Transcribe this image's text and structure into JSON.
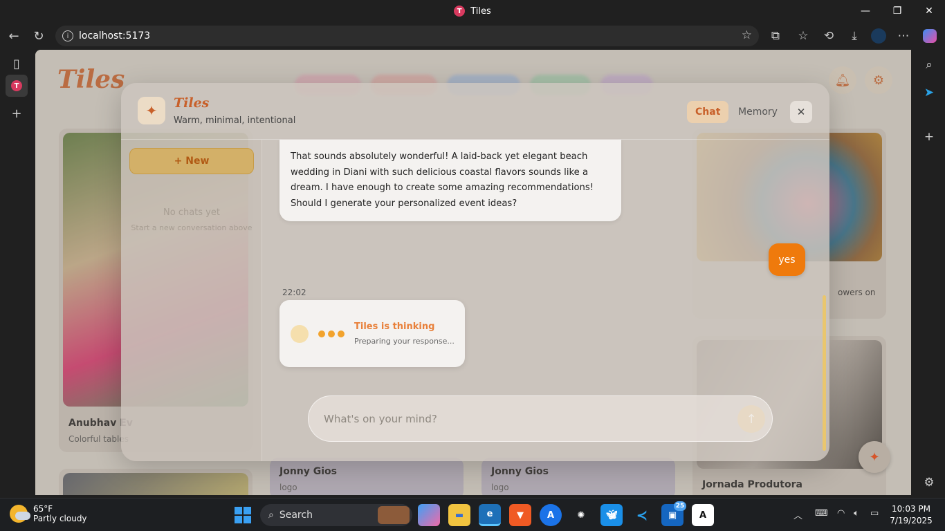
{
  "window": {
    "title": "Tiles",
    "favicon_letter": "T"
  },
  "browser": {
    "address": "localhost:5173"
  },
  "page": {
    "logo": "Tiles",
    "cards": [
      {
        "title": "Anubhav Ev",
        "subtitle": "Colorful tables"
      },
      {
        "title": "Jonny Gios",
        "subtitle": "logo"
      },
      {
        "title": "Jonny Gios",
        "subtitle": "logo"
      },
      {
        "title": "Jornada Produtora",
        "subtitle": ""
      },
      {
        "title": "",
        "subtitle": "owers on"
      }
    ]
  },
  "modal": {
    "title": "Tiles",
    "subtitle": "Warm, minimal, intentional",
    "tabs": [
      {
        "label": "Chat",
        "active": true
      },
      {
        "label": "Memory",
        "active": false
      }
    ],
    "close": "✕",
    "sidebar": {
      "new_label": "+ New",
      "empty_title": "No chats yet",
      "empty_sub": "Start a new conversation above"
    },
    "messages": [
      {
        "role": "assistant",
        "text": "That sounds absolutely wonderful! A laid-back yet elegant beach wedding in Diani with such delicious coastal flavors sounds like a dream. I have enough to create some amazing recommendations! Should I generate your personalized event ideas?"
      },
      {
        "role": "user",
        "text": "yes"
      }
    ],
    "timestamp": "22:02",
    "thinking": {
      "title": "Tiles is thinking",
      "subtitle": "Preparing your response..."
    },
    "composer_placeholder": "What's on your mind?"
  },
  "taskbar": {
    "weather_temp": "65°F",
    "weather_desc": "Partly cloudy",
    "search_label": "Search",
    "badge": "25",
    "time": "10:03 PM",
    "date": "7/19/2025"
  },
  "colors": {
    "accent": "#c8602a",
    "user_bubble": "#ef7a0c",
    "thinking_dots": "#f2a32d"
  }
}
